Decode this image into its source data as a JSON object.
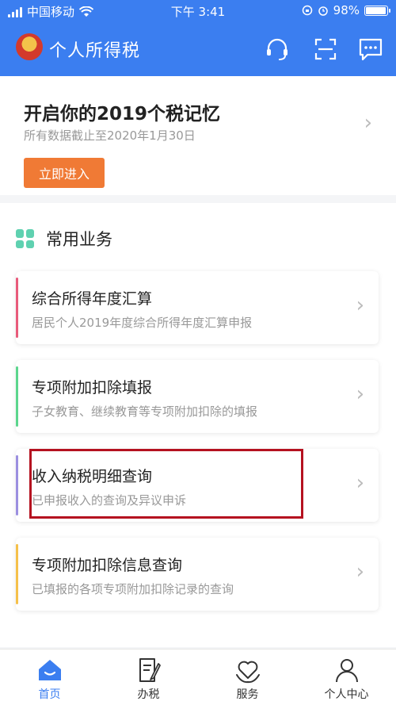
{
  "status_bar": {
    "carrier": "中国移动",
    "time": "下午 3:41",
    "battery": "98%",
    "battery_level": 0.98
  },
  "header": {
    "title": "个人所得税",
    "icons": [
      "headset-icon",
      "scan-icon",
      "message-icon"
    ]
  },
  "banner": {
    "title": "开启你的2019个税记忆",
    "subtitle": "所有数据截止至2020年1月30日",
    "button": "立即进入"
  },
  "services": {
    "title": "常用业务",
    "items": [
      {
        "title": "综合所得年度汇算",
        "subtitle": "居民个人2019年度综合所得年度汇算申报",
        "accent": "#e85a7a"
      },
      {
        "title": "专项附加扣除填报",
        "subtitle": "子女教育、继续教育等专项附加扣除的填报",
        "accent": "#5bd68d"
      },
      {
        "title": "收入纳税明细查询",
        "subtitle": "已申报收入的查询及异议申诉",
        "accent": "#9b8fe0"
      },
      {
        "title": "专项附加扣除信息查询",
        "subtitle": "已填报的各项专项附加扣除记录的查询",
        "accent": "#f5c04a"
      }
    ]
  },
  "tabbar": {
    "tabs": [
      {
        "label": "首页",
        "icon": "home-icon",
        "active": true
      },
      {
        "label": "办税",
        "icon": "tax-form-icon",
        "active": false
      },
      {
        "label": "服务",
        "icon": "service-heart-icon",
        "active": false
      },
      {
        "label": "个人中心",
        "icon": "user-icon",
        "active": false
      }
    ]
  },
  "colors": {
    "primary": "#3b7ef0",
    "cta": "#f07a35",
    "highlight": "#b51220"
  }
}
